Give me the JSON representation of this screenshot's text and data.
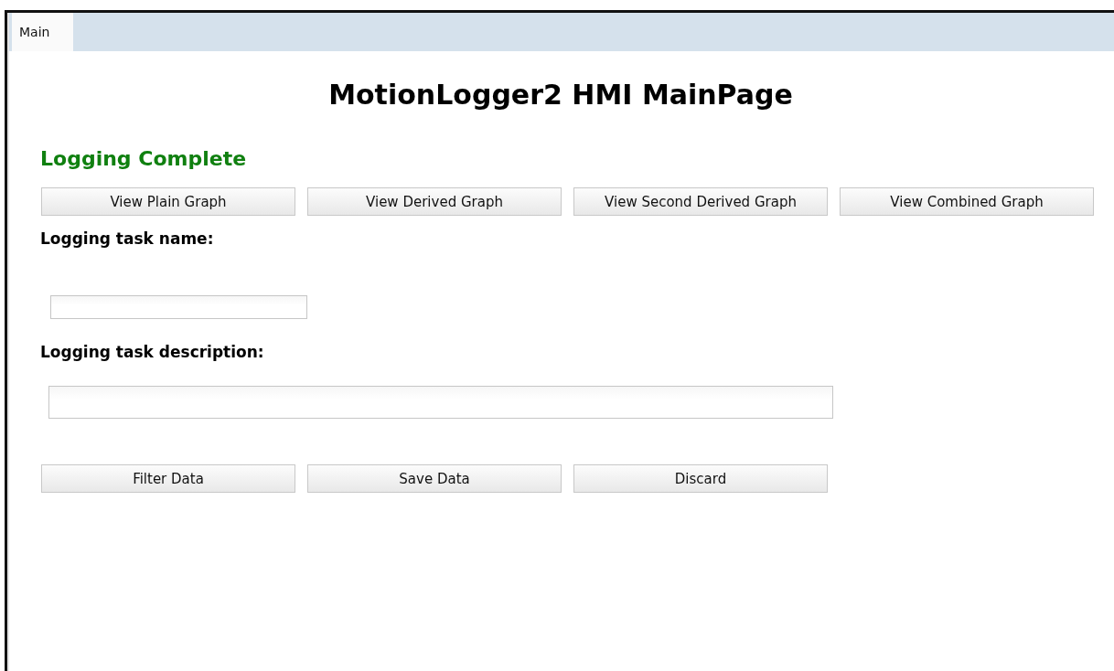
{
  "tabs": [
    {
      "label": "Main",
      "selected": true
    }
  ],
  "title": "MotionLogger2 HMI MainPage",
  "status": {
    "text": "Logging Complete",
    "color": "#108010"
  },
  "graph_buttons": [
    "View Plain Graph",
    "View Derived Graph",
    "View Second Derived Graph",
    "View Combined Graph"
  ],
  "task_name": {
    "label": "Logging task name:"
  },
  "task_description": {
    "label": "Logging task description:"
  },
  "action_buttons": [
    "Filter Data",
    "Save Data",
    "Discard"
  ]
}
